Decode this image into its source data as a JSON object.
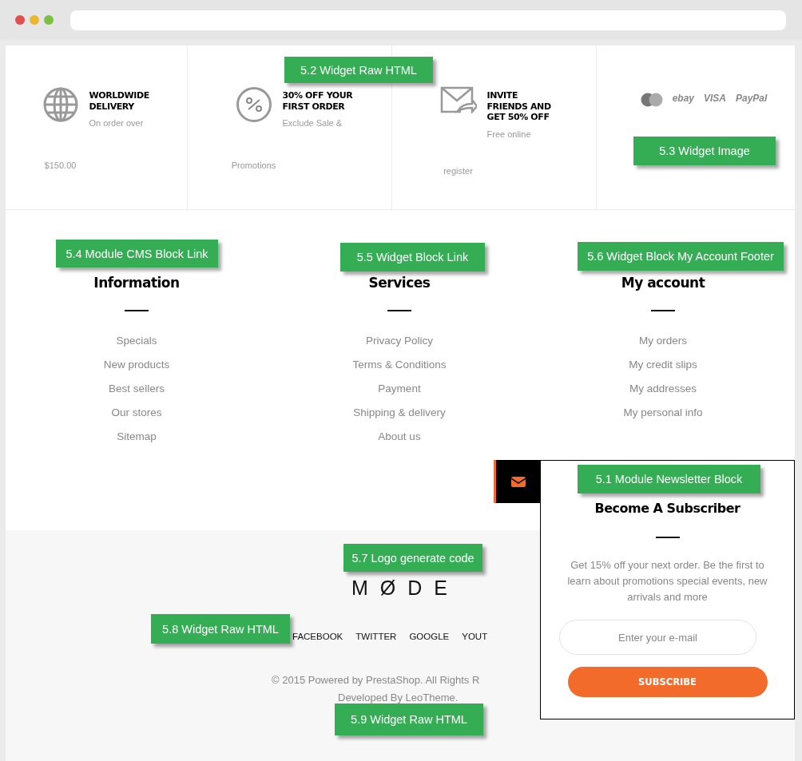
{
  "features": [
    {
      "kind": "globe",
      "title": "WORLDWIDE DELIVERY",
      "description": [
        "On order over",
        "$150.00"
      ]
    },
    {
      "kind": "percent",
      "title": "30% OFF YOUR FIRST ORDER",
      "description": [
        "Exclude Sale &",
        "Promotions"
      ]
    },
    {
      "kind": "mail",
      "title": "INVITE FRIENDS AND GET 50% OFF",
      "description": [
        "Free online",
        "register"
      ]
    }
  ],
  "payments": [
    {
      "kind": "card"
    },
    {
      "kind": "text",
      "label": "ebay"
    },
    {
      "kind": "text",
      "label": "VISA"
    },
    {
      "kind": "text",
      "label": "PayPal"
    }
  ],
  "link_columns": [
    {
      "title": "Information",
      "links": [
        "Specials",
        "New products",
        "Best sellers",
        "Our stores",
        "Sitemap"
      ]
    },
    {
      "title": "Services",
      "links": [
        "Privacy Policy",
        "Terms & Conditions",
        "Payment",
        "Shipping & delivery",
        "About us"
      ]
    },
    {
      "title": "My account",
      "links": [
        "My orders",
        "My credit slips",
        "My addresses",
        "My personal info"
      ]
    }
  ],
  "newsletter": {
    "title": "Become A Subscriber",
    "text": "Get 15% off your next order. Be the first to learn about promotions special events, new arrivals and more",
    "placeholder": "Enter your e-mail",
    "button": "SUBSCRIBE"
  },
  "footer": {
    "logo": "MØDE",
    "social": [
      "FACEBOOK",
      "TWITTER",
      "GOOGLE",
      "YOUT"
    ],
    "copyright": "© 2015 Powered by PrestaShop. All Rights R",
    "developer": "Developed By LeoTheme."
  },
  "annotations": [
    "5.2 Widget Raw HTML",
    "5.3 Widget Image",
    "5.4 Module CMS Block Link",
    "5.5 Widget Block Link",
    "5.6 Widget Block My Account Footer",
    "5.1 Module Newsletter Block",
    "5.7 Logo generate code",
    "5.8 Widget Raw HTML",
    "5.9 Widget Raw HTML"
  ]
}
